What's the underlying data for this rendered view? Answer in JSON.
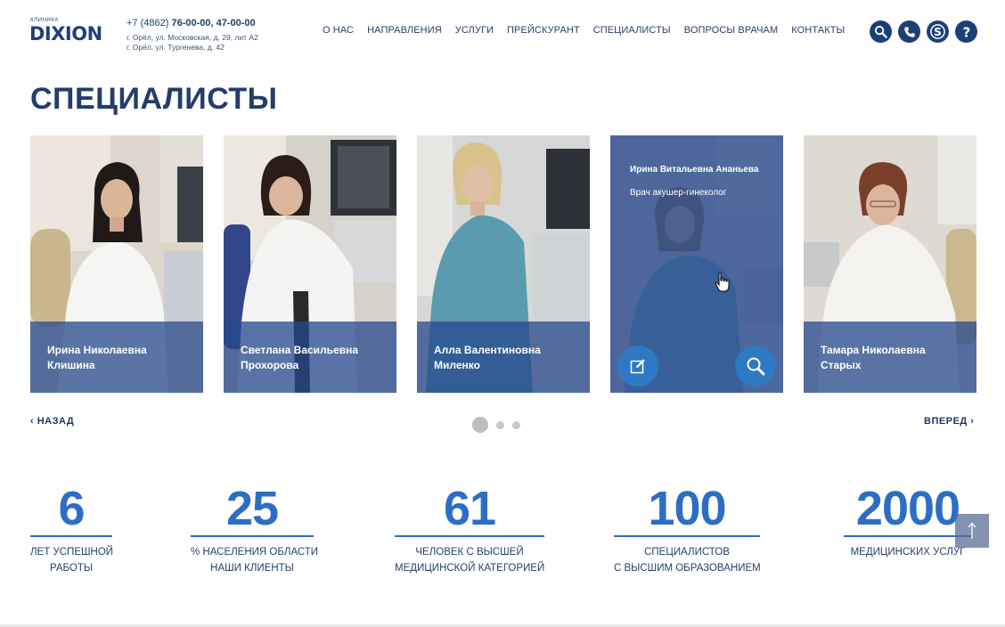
{
  "logo": {
    "small": "КЛИНИКА",
    "main": "DIXION"
  },
  "contacts": {
    "phone_prefix": "+7 (4862) ",
    "phone_numbers": "76-00-00, 47-00-00",
    "address1": "г. Орёл, ул. Московская, д. 29, лит А2",
    "address2": "г. Орёл, ул. Тургенева, д. 42"
  },
  "nav": [
    "О НАС",
    "НАПРАВЛЕНИЯ",
    "УСЛУГИ",
    "ПРЕЙСКУРАНТ",
    "СПЕЦИАЛИСТЫ",
    "ВОПРОСЫ ВРАЧАМ",
    "КОНТАКТЫ"
  ],
  "header_icons": [
    "search-icon",
    "phone-icon",
    "skype-icon",
    "help-icon"
  ],
  "page_title": "СПЕЦИАЛИСТЫ",
  "specialists": [
    {
      "name": "Ирина Николаевна Клишина"
    },
    {
      "name": "Светлана Васильевна Прохорова"
    },
    {
      "name": "Алла Валентиновна Миленко"
    },
    {
      "name": "Ирина Витальевна Ананьева",
      "position": "Врач акушер-гинеколог",
      "hover": true
    },
    {
      "name": "Тамара Николаевна Старых"
    }
  ],
  "slider": {
    "prev_label": "НАЗАД",
    "next_label": "ВПЕРЕД",
    "pages": 3,
    "active_page": 1
  },
  "stats": [
    {
      "value": "6",
      "line1": "ЛЕТ УСПЕШНОЙ",
      "line2": "РАБОТЫ"
    },
    {
      "value": "25",
      "line1": "% НАСЕЛЕНИЯ ОБЛАСТИ",
      "line2": "НАШИ КЛИЕНТЫ"
    },
    {
      "value": "61",
      "line1": "ЧЕЛОВЕК С ВЫСШЕЙ",
      "line2": "МЕДИЦИНСКОЙ КАТЕГОРИЕЙ"
    },
    {
      "value": "100",
      "line1": "СПЕЦИАЛИСТОВ",
      "line2": "С ВЫСШИМ ОБРАЗОВАНИЕМ"
    },
    {
      "value": "2000",
      "line1": "МЕДИЦИНСКИХ УСЛУГ",
      "line2": ""
    }
  ],
  "colors": {
    "brand": "#1d3f78",
    "accent": "#2d6ec4",
    "overlay": "#26488c"
  }
}
